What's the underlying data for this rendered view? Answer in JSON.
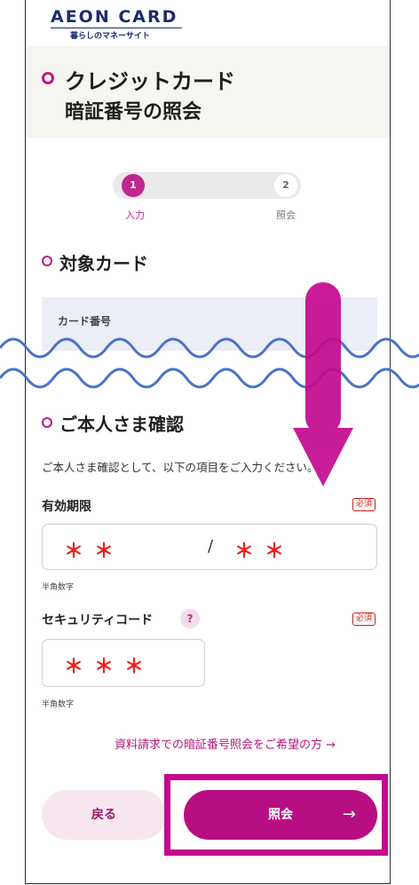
{
  "header": {
    "logo_main": "AEON CARD",
    "logo_sub": "暮らしのマネーサイト"
  },
  "page_title": {
    "line1": "クレジットカード",
    "line2": "暗証番号の照会"
  },
  "stepper": {
    "current_step": 1,
    "steps": [
      {
        "number": "1",
        "label": "入力"
      },
      {
        "number": "2",
        "label": "照会"
      }
    ]
  },
  "section_card": {
    "title": "対象カード",
    "card_number_label": "カード番号"
  },
  "section_identity": {
    "title": "ご本人さま確認",
    "description": "ご本人さま確認として、以下の項目をご入力ください。"
  },
  "expiry": {
    "label": "有効期限",
    "required": "必須",
    "month_value": "＊＊",
    "separator": "/",
    "year_value": "＊＊",
    "hint": "半角数字"
  },
  "security_code": {
    "label": "セキュリティコード",
    "help_icon": "?",
    "required": "必須",
    "value": "＊＊＊",
    "hint": "半角数字"
  },
  "link_text": "資料請求での暗証番号照会をご希望の方 →",
  "buttons": {
    "back": "戻る",
    "submit": "照会",
    "submit_arrow": "→"
  },
  "colors": {
    "accent": "#c0278f",
    "submit_button": "#b80e83",
    "annotation_arrow": "#c3098f",
    "wave_lines": "#4a72c8",
    "required_badge": "#d02020",
    "masked_value": "#e8211f"
  }
}
